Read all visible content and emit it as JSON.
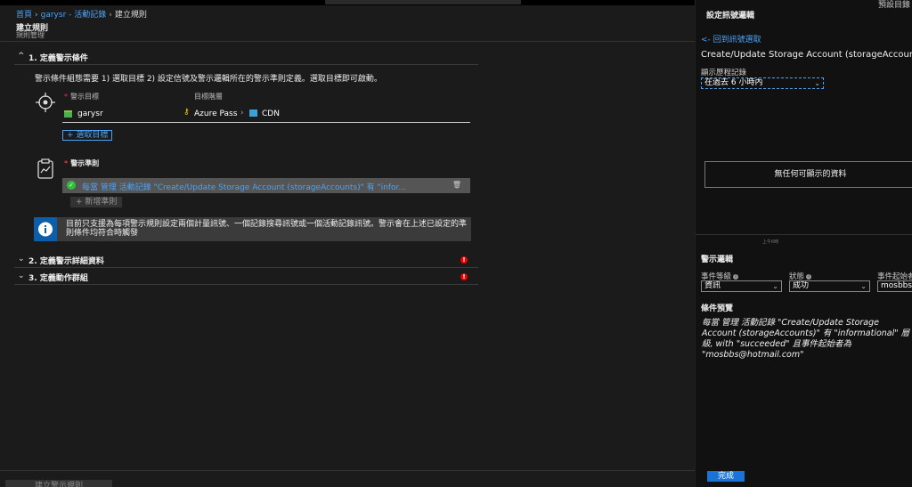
{
  "topright": "預設目錄",
  "breadcrumb": {
    "home": "首頁",
    "resource": "garysr - 活動記錄",
    "current": "建立規則"
  },
  "page": {
    "title": "建立規則",
    "subtitle": "規則管理"
  },
  "section1": {
    "label": "1. 定義警示條件"
  },
  "description": "警示條件組態需要 1) 選取目標 2) 設定信號及警示邏輯所在的警示準則定義。選取目標即可啟動。",
  "target": {
    "label": "警示目標",
    "hierarchy_label": "目標階層",
    "resource": "garysr",
    "subscription": "Azure Pass",
    "resource_group": "CDN",
    "select_button": "+ 選取目標"
  },
  "criteria": {
    "label": "警示準則",
    "rule_text": "每當 管理 活動記錄 \"Create/Update Storage Account (storageAccounts)\" 有 \"infor...",
    "add_button": "+ 新增準則"
  },
  "info_text": "目前只支援為每項警示規則設定兩個計量訊號、一個記錄搜尋訊號或一個活動記錄訊號。警示會在上述已設定的準則條件均符合時觸發",
  "section2": {
    "label": "2. 定義警示詳細資料"
  },
  "section3": {
    "label": "3. 定義動作群組"
  },
  "footer": {
    "create_button": "建立警示規則"
  },
  "panel": {
    "title": "設定訊號邏輯",
    "back_link": "<- 回到訊號選取",
    "operation": "Create/Update Storage Account (storageAccounts)",
    "history_label": "顯示歷程記錄",
    "history_value": "在過去 6 小時內",
    "no_data": "無任何可顯示的資料",
    "tiny_label": "上午6時",
    "alert_logic_label": "警示邏輯",
    "level_label": "事件等級",
    "level_value": "資訊",
    "status_label": "狀態",
    "status_value": "成功",
    "initiator_label": "事件起始者",
    "initiator_value": "mosbbs@",
    "preview_label": "條件預覽",
    "preview_text": "每當 管理 活動記錄 \"Create/Update Storage Account (storageAccounts)\" 有 \"informational\" 層級, with \"succeeded\" 且事件起始者為 \"mosbbs@hotmail.com\"",
    "done_button": "完成"
  },
  "colors": {
    "accent": "#4ba3f5",
    "error": "#e00000",
    "success": "#2fbf3a",
    "info": "#0c5ea8"
  }
}
